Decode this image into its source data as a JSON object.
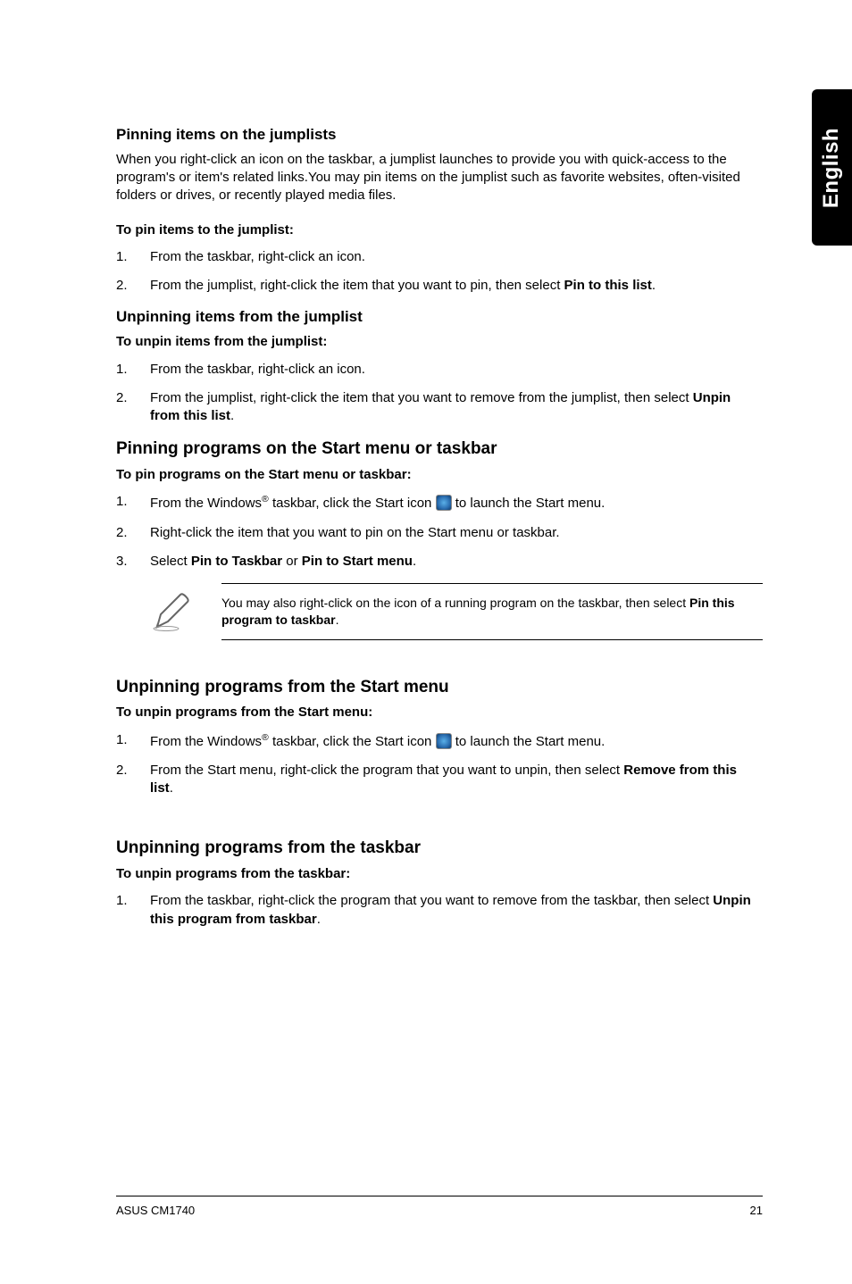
{
  "side_tab": "English",
  "sec1": {
    "heading": "Pinning items on the jumplists",
    "intro": "When you right-click an icon on the taskbar, a jumplist launches to provide you with quick-access to the program's or item's related links.You may pin items on the jumplist such as favorite websites, often-visited folders or drives, or recently played media files.",
    "sub": "To pin items to the jumplist:",
    "steps": [
      "From the taskbar, right-click an icon.",
      {
        "pre": "From the jumplist, right-click the item that you want to pin, then select ",
        "bold": "Pin to this list",
        "post": "."
      }
    ]
  },
  "sec2": {
    "heading": "Unpinning items from the jumplist",
    "sub": "To unpin items from the jumplist:",
    "steps": [
      "From the taskbar, right-click an icon.",
      {
        "pre": "From the jumplist, right-click the item that you want to remove from the jumplist, then select ",
        "bold": "Unpin from this list",
        "post": "."
      }
    ]
  },
  "sec3": {
    "heading": "Pinning programs on the Start menu or taskbar",
    "sub": "To pin programs on the Start menu or taskbar:",
    "step1pre": "From the Windows",
    "step1mid": " taskbar, click the Start icon ",
    "step1post": " to launch the Start menu.",
    "step2": "Right-click the item that you want to pin on the Start menu or taskbar.",
    "step3pre": "Select ",
    "step3b1": "Pin to Taskbar",
    "step3or": " or ",
    "step3b2": "Pin to Start menu",
    "step3post": ".",
    "note_pre": "You may also right-click on the icon of a running program on the taskbar, then select ",
    "note_bold": "Pin this program to taskbar",
    "note_post": "."
  },
  "sec4": {
    "heading": "Unpinning programs from the Start menu",
    "sub": "To unpin programs from the Start menu:",
    "step1pre": "From the Windows",
    "step1mid": " taskbar, click the Start icon ",
    "step1post": " to launch the Start menu.",
    "step2pre": "From the Start menu, right-click the program that you want to unpin, then select ",
    "step2bold": "Remove from this list",
    "step2post": "."
  },
  "sec5": {
    "heading": "Unpinning programs from the taskbar",
    "sub": "To unpin programs from the taskbar:",
    "step1pre": "From the taskbar, right-click the program that you want to remove from the taskbar, then select ",
    "step1bold": "Unpin this program from taskbar",
    "step1post": "."
  },
  "footer": {
    "left": "ASUS CM1740",
    "right": "21"
  }
}
